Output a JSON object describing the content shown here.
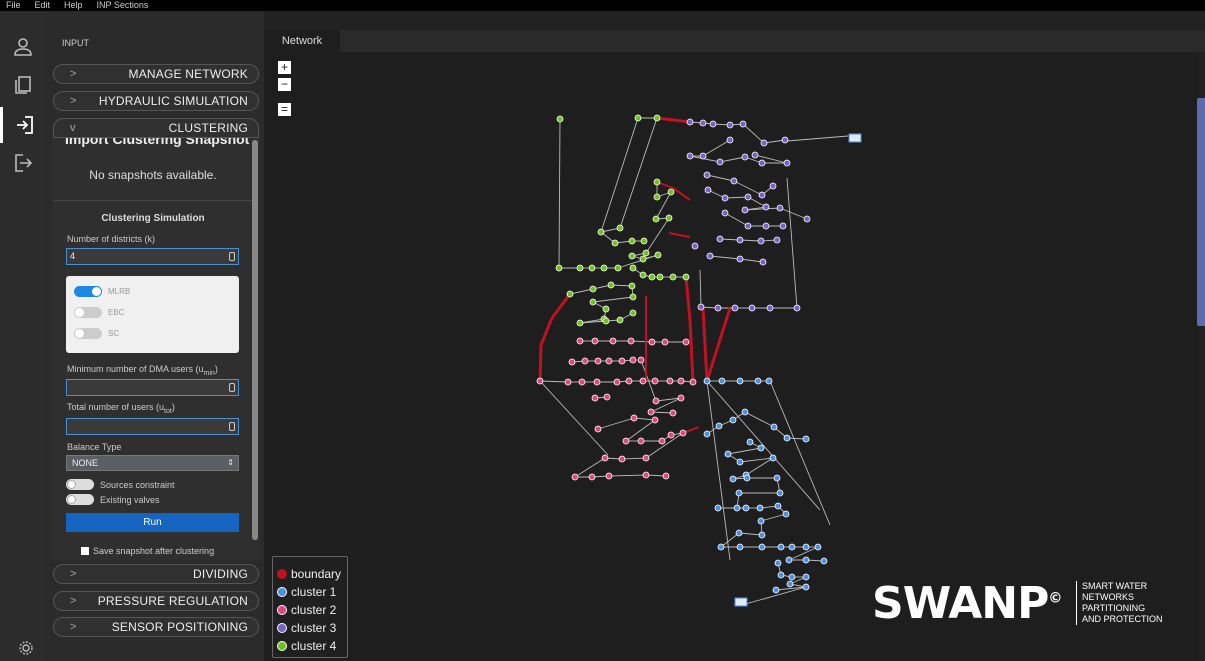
{
  "menu": [
    "File",
    "Edit",
    "Help",
    "INP Sections"
  ],
  "panel": {
    "header": "INPUT",
    "sections": [
      {
        "label": "MANAGE NETWORK",
        "chevron": ">"
      },
      {
        "label": "HYDRAULIC SIMULATION",
        "chevron": ">"
      },
      {
        "label": "CLUSTERING",
        "chevron": "v"
      },
      {
        "label": "DIVIDING",
        "chevron": ">"
      },
      {
        "label": "PRESSURE REGULATION",
        "chevron": ">"
      },
      {
        "label": "SENSOR POSITIONING",
        "chevron": ">"
      }
    ],
    "clustering": {
      "snapshot_title": "Import Clustering Snapshot",
      "snapshot_empty": "No snapshots available.",
      "sim_title": "Clustering Simulation",
      "k_label": "Number of districts (k)",
      "k_value": "4",
      "algorithms": [
        {
          "label": "MLRB",
          "on": true
        },
        {
          "label": "EBC",
          "on": false
        },
        {
          "label": "SC",
          "on": false
        }
      ],
      "min_users_label": "Minimum number of DMA users (u",
      "min_users_sub": "min",
      "min_users_close": ")",
      "tot_users_label": "Total number of users (u",
      "tot_users_sub": "tot",
      "tot_users_close": ")",
      "balance_label": "Balance Type",
      "balance_value": "NONE",
      "sources_label": "Sources constraint",
      "valves_label": "Existing valves",
      "run_label": "Run",
      "save_label": "Save snapshot after clustering"
    }
  },
  "network": {
    "tab": "Network",
    "zoom_in": "+",
    "zoom_out": "−",
    "fit": "="
  },
  "legend": [
    {
      "label": "boundary",
      "color": "#c1121f"
    },
    {
      "label": "cluster 1",
      "color": "#4a90e2"
    },
    {
      "label": "cluster 2",
      "color": "#e0457b"
    },
    {
      "label": "cluster 3",
      "color": "#7a5fc9"
    },
    {
      "label": "cluster 4",
      "color": "#6cc417"
    }
  ],
  "brand": {
    "word": "SWANP",
    "mark": "©",
    "tagline": [
      "SMART WATER",
      "NETWORKS",
      "PARTITIONING",
      "AND PROTECTION"
    ]
  },
  "colors": {
    "boundary": "#c1121f",
    "cluster1": "#4a90e2",
    "cluster2": "#e0457b",
    "cluster3": "#7a5fc9",
    "cluster4": "#6cc417",
    "edge": "#bbbbbb",
    "accent": "#1565c0"
  }
}
